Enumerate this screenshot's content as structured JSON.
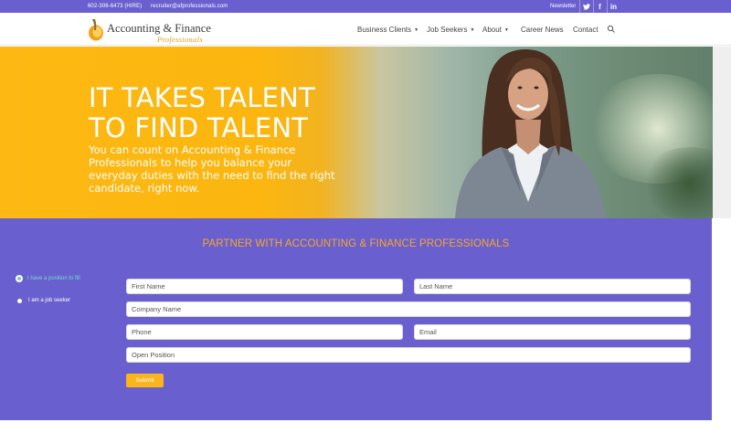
{
  "topbar": {
    "phone": "602-306-6473 (HIRE)",
    "email": "recruiter@afprofessionals.com",
    "newsletter": "Newsletter",
    "social": [
      {
        "icon": "twitter-icon",
        "glyph": "🐦"
      },
      {
        "icon": "facebook-icon",
        "glyph": "f"
      },
      {
        "icon": "linkedin-icon",
        "glyph": "in"
      }
    ]
  },
  "logo": {
    "line1": "Accounting & Finance",
    "line2": "Professionals"
  },
  "nav": {
    "items": [
      {
        "label": "Business Clients",
        "caret": "▼"
      },
      {
        "label": "Job Seekers",
        "caret": "▼"
      },
      {
        "label": "About",
        "caret": "▼"
      },
      {
        "label": "Career News",
        "caret": ""
      },
      {
        "label": "Contact",
        "caret": ""
      }
    ],
    "search_icon": "search-icon"
  },
  "hero": {
    "title_line1": "IT TAKES TALENT",
    "title_line2": "TO FIND TALENT",
    "subtitle": "You can count on Accounting & Finance Professionals to help you balance your everyday duties with the need to find the right candidate, right now."
  },
  "form": {
    "heading": "PARTNER WITH ACCOUNTING & FINANCE PROFESSIONALS",
    "radios": [
      {
        "label": "I have a position to fill",
        "selected": true
      },
      {
        "label": "I am a job seeker",
        "selected": false
      }
    ],
    "first_name_placeholder": "First Name",
    "last_name_placeholder": "Last Name",
    "company_placeholder": "Company Name",
    "phone_placeholder": "Phone",
    "email_placeholder": "Email",
    "position_placeholder": "Open Position",
    "submit_label": "Submit"
  },
  "colors": {
    "brand_purple": "#6a5fcf",
    "hero_yellow": "#fdb813",
    "heading_orange": "#f4a72c",
    "submit_yellow": "#fbb41a"
  }
}
